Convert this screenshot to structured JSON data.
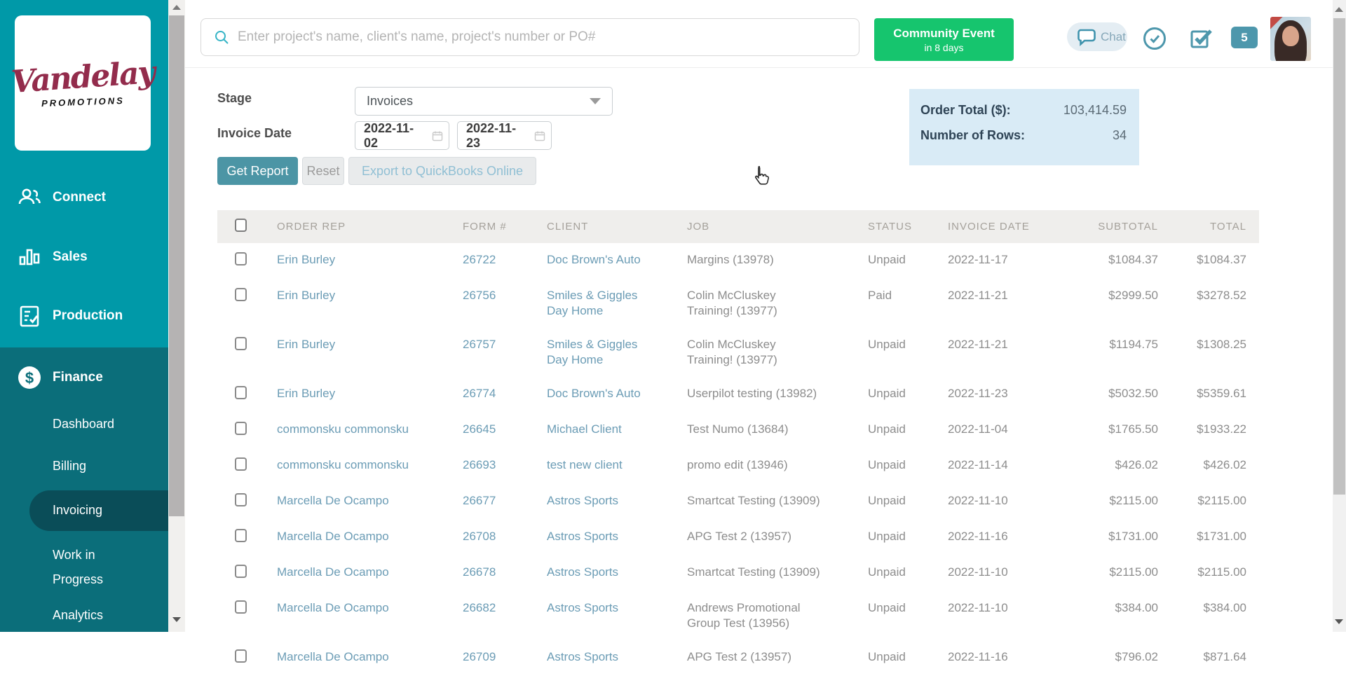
{
  "colors": {
    "sidebar_teal": "#0099a8",
    "finance_section_bg": "#0b6e7a",
    "active_item_bg": "#0a4d58",
    "logo_maroon": "#932c4c",
    "community_green": "#16c56e",
    "icon_teal": "#4d97ac",
    "link_blue": "#6b9cb5",
    "primary_button": "#4c95a5",
    "summary_bg": "#d9ebf6",
    "table_header_bg": "#efeeec"
  },
  "sidebar": {
    "logo": {
      "line1": "Vandelay",
      "line2": "PROMOTIONS"
    },
    "items": [
      {
        "label": "Connect",
        "icon": "people-icon"
      },
      {
        "label": "Sales",
        "icon": "bar-chart-icon"
      },
      {
        "label": "Production",
        "icon": "clipboard-check-icon"
      },
      {
        "label": "Finance",
        "icon": "dollar-circle-icon"
      }
    ],
    "finance_sub": [
      {
        "label": "Dashboard",
        "active": false
      },
      {
        "label": "Billing",
        "active": false
      },
      {
        "label": "Invoicing",
        "active": true
      },
      {
        "label": "Work in Progress",
        "active": false
      },
      {
        "label": "Analytics",
        "active": false
      }
    ]
  },
  "header": {
    "search_placeholder": "Enter project's name, client's name, project's number or PO#",
    "community_event": {
      "line1": "Community Event",
      "line2": "in 8 days"
    },
    "chat_label": "Chat",
    "notification_count": "5",
    "icons": {
      "search": "magnifier",
      "chat": "speech-bubble",
      "clock": "clock",
      "tasks": "checked-box",
      "avatar": "user-photo"
    }
  },
  "filters": {
    "stage_label": "Stage",
    "stage_value": "Invoices",
    "invoice_date_label": "Invoice Date",
    "date_from": "2022-11-02",
    "date_to": "2022-11-23",
    "get_report_label": "Get Report",
    "reset_label": "Reset",
    "export_label": "Export to QuickBooks Online"
  },
  "summary": {
    "order_total_label": "Order Total ($):",
    "order_total_value": "103,414.59",
    "rows_label": "Number of Rows:",
    "rows_value": "34"
  },
  "table": {
    "columns": [
      {
        "key": "rep",
        "label": "ORDER REP",
        "align": "left"
      },
      {
        "key": "form",
        "label": "FORM #",
        "align": "left"
      },
      {
        "key": "client",
        "label": "CLIENT",
        "align": "left"
      },
      {
        "key": "job",
        "label": "JOB",
        "align": "left"
      },
      {
        "key": "status",
        "label": "STATUS",
        "align": "left"
      },
      {
        "key": "date",
        "label": "INVOICE DATE",
        "align": "left"
      },
      {
        "key": "subtotal",
        "label": "SUBTOTAL",
        "align": "right"
      },
      {
        "key": "total",
        "label": "TOTAL",
        "align": "right"
      }
    ],
    "rows": [
      {
        "rep": "Erin Burley",
        "form": "26722",
        "client": "Doc Brown's Auto",
        "job": "Margins (13978)",
        "status": "Unpaid",
        "date": "2022-11-17",
        "subtotal": "$1084.37",
        "total": "$1084.37"
      },
      {
        "rep": "Erin Burley",
        "form": "26756",
        "client": "Smiles & Giggles\nDay Home",
        "job": "Colin McCluskey\nTraining! (13977)",
        "status": "Paid",
        "date": "2022-11-21",
        "subtotal": "$2999.50",
        "total": "$3278.52"
      },
      {
        "rep": "Erin Burley",
        "form": "26757",
        "client": "Smiles & Giggles\nDay Home",
        "job": "Colin McCluskey\nTraining! (13977)",
        "status": "Unpaid",
        "date": "2022-11-21",
        "subtotal": "$1194.75",
        "total": "$1308.25"
      },
      {
        "rep": "Erin Burley",
        "form": "26774",
        "client": "Doc Brown's Auto",
        "job": "Userpilot testing (13982)",
        "status": "Unpaid",
        "date": "2022-11-23",
        "subtotal": "$5032.50",
        "total": "$5359.61"
      },
      {
        "rep": "commonsku commonsku",
        "form": "26645",
        "client": "Michael Client",
        "job": "Test Numo (13684)",
        "status": "Unpaid",
        "date": "2022-11-04",
        "subtotal": "$1765.50",
        "total": "$1933.22"
      },
      {
        "rep": "commonsku commonsku",
        "form": "26693",
        "client": "test new client",
        "job": "promo edit (13946)",
        "status": "Unpaid",
        "date": "2022-11-14",
        "subtotal": "$426.02",
        "total": "$426.02"
      },
      {
        "rep": "Marcella De Ocampo",
        "form": "26677",
        "client": "Astros Sports",
        "job": "Smartcat Testing (13909)",
        "status": "Unpaid",
        "date": "2022-11-10",
        "subtotal": "$2115.00",
        "total": "$2115.00"
      },
      {
        "rep": "Marcella De Ocampo",
        "form": "26708",
        "client": "Astros Sports",
        "job": "APG Test 2 (13957)",
        "status": "Unpaid",
        "date": "2022-11-16",
        "subtotal": "$1731.00",
        "total": "$1731.00"
      },
      {
        "rep": "Marcella De Ocampo",
        "form": "26678",
        "client": "Astros Sports",
        "job": "Smartcat Testing (13909)",
        "status": "Unpaid",
        "date": "2022-11-10",
        "subtotal": "$2115.00",
        "total": "$2115.00"
      },
      {
        "rep": "Marcella De Ocampo",
        "form": "26682",
        "client": "Astros Sports",
        "job": "Andrews Promotional\nGroup Test (13956)",
        "status": "Unpaid",
        "date": "2022-11-10",
        "subtotal": "$384.00",
        "total": "$384.00"
      },
      {
        "rep": "Marcella De Ocampo",
        "form": "26709",
        "client": "Astros Sports",
        "job": "APG Test 2 (13957)",
        "status": "Unpaid",
        "date": "2022-11-16",
        "subtotal": "$796.02",
        "total": "$871.64"
      }
    ]
  }
}
